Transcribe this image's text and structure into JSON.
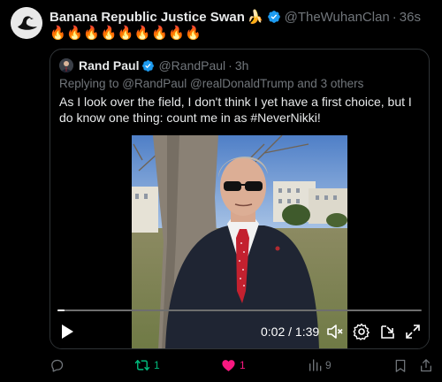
{
  "tweet": {
    "author_name": "Banana Republic Justice Swan",
    "author_emoji": "🍌",
    "handle": "@TheWuhanClan",
    "separator": "·",
    "time": "36s",
    "body": "🔥🔥🔥🔥🔥🔥🔥🔥🔥"
  },
  "quote": {
    "author_name": "Rand Paul",
    "handle": "@RandPaul",
    "separator": "·",
    "time": "3h",
    "replying_to": "Replying to @RandPaul @realDonaldTrump and 3 others",
    "text": "As I look over the field, I don't think I yet have a first choice, but I do know one thing: count me in as #NeverNikki!",
    "video": {
      "current_time": "0:02",
      "duration": "1:39",
      "time_display": "0:02 / 1:39",
      "progress_fraction": 0.02
    }
  },
  "actions": {
    "reply_count": "",
    "retweet_count": "1",
    "like_count": "1",
    "view_count": "9"
  },
  "colors": {
    "background": "#000000",
    "text": "#e7e9ea",
    "muted": "#71767b",
    "verified": "#1d9bf0",
    "retweet_active": "#00ba7c",
    "like_active": "#f91880",
    "border": "#2f3336"
  },
  "icons": {
    "avatar": "swan-avatar-icon",
    "verified": "verified-badge-icon",
    "reply": "reply-icon",
    "retweet": "retweet-icon",
    "like": "heart-icon",
    "views": "views-icon",
    "bookmark": "bookmark-icon",
    "share": "share-icon"
  }
}
